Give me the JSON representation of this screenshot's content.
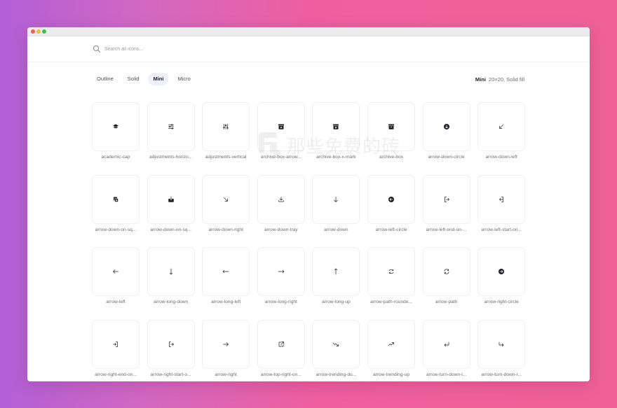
{
  "window": {
    "controls": [
      "close",
      "minimize",
      "zoom"
    ]
  },
  "search": {
    "placeholder": "Search all icons...",
    "value": ""
  },
  "tabs": [
    {
      "label": "Outline",
      "active": false
    },
    {
      "label": "Solid",
      "active": false
    },
    {
      "label": "Mini",
      "active": true
    },
    {
      "label": "Micro",
      "active": false
    }
  ],
  "style_info": {
    "name": "Mini",
    "description": "20×20, Solid fill"
  },
  "watermark": {
    "text": "那些免费的砖"
  },
  "icons": [
    {
      "name": "academic-cap",
      "icon": "academic-cap-icon"
    },
    {
      "name": "adjustments-horizo...",
      "icon": "adjustments-horizontal-icon"
    },
    {
      "name": "adjustments-vertical",
      "icon": "adjustments-vertical-icon"
    },
    {
      "name": "archive-box-arrow...",
      "icon": "archive-box-arrow-icon"
    },
    {
      "name": "archive-box-x-mark",
      "icon": "archive-box-x-mark-icon"
    },
    {
      "name": "archive-box",
      "icon": "archive-box-icon"
    },
    {
      "name": "arrow-down-circle",
      "icon": "arrow-down-circle-icon"
    },
    {
      "name": "arrow-down-left",
      "icon": "arrow-down-left-icon"
    },
    {
      "name": "arrow-down-on-sq...",
      "icon": "arrow-down-on-square-stack-icon"
    },
    {
      "name": "arrow-down-on-sq...",
      "icon": "arrow-down-on-square-icon"
    },
    {
      "name": "arrow-down-right",
      "icon": "arrow-down-right-icon"
    },
    {
      "name": "arrow-down-tray",
      "icon": "arrow-down-tray-icon"
    },
    {
      "name": "arrow-down",
      "icon": "arrow-down-icon"
    },
    {
      "name": "arrow-left-circle",
      "icon": "arrow-left-circle-icon"
    },
    {
      "name": "arrow-left-end-on-...",
      "icon": "arrow-left-end-on-rectangle-icon"
    },
    {
      "name": "arrow-left-start-on...",
      "icon": "arrow-left-start-on-rectangle-icon"
    },
    {
      "name": "arrow-left",
      "icon": "arrow-left-icon"
    },
    {
      "name": "arrow-long-down",
      "icon": "arrow-long-down-icon"
    },
    {
      "name": "arrow-long-left",
      "icon": "arrow-long-left-icon"
    },
    {
      "name": "arrow-long-right",
      "icon": "arrow-long-right-icon"
    },
    {
      "name": "arrow-long-up",
      "icon": "arrow-long-up-icon"
    },
    {
      "name": "arrow-path-rounde...",
      "icon": "arrow-path-rounded-square-icon"
    },
    {
      "name": "arrow-path",
      "icon": "arrow-path-icon"
    },
    {
      "name": "arrow-right-circle",
      "icon": "arrow-right-circle-icon"
    },
    {
      "name": "arrow-right-end-on...",
      "icon": "arrow-right-end-on-rectangle-icon"
    },
    {
      "name": "arrow-right-start-o...",
      "icon": "arrow-right-start-on-rectangle-icon"
    },
    {
      "name": "arrow-right",
      "icon": "arrow-right-icon"
    },
    {
      "name": "arrow-top-right-on...",
      "icon": "arrow-top-right-on-square-icon"
    },
    {
      "name": "arrow-trending-do...",
      "icon": "arrow-trending-down-icon"
    },
    {
      "name": "arrow-trending-up",
      "icon": "arrow-trending-up-icon"
    },
    {
      "name": "arrow-turn-down-l...",
      "icon": "arrow-turn-down-left-icon"
    },
    {
      "name": "arrow-turn-down-r...",
      "icon": "arrow-turn-down-right-icon"
    }
  ]
}
